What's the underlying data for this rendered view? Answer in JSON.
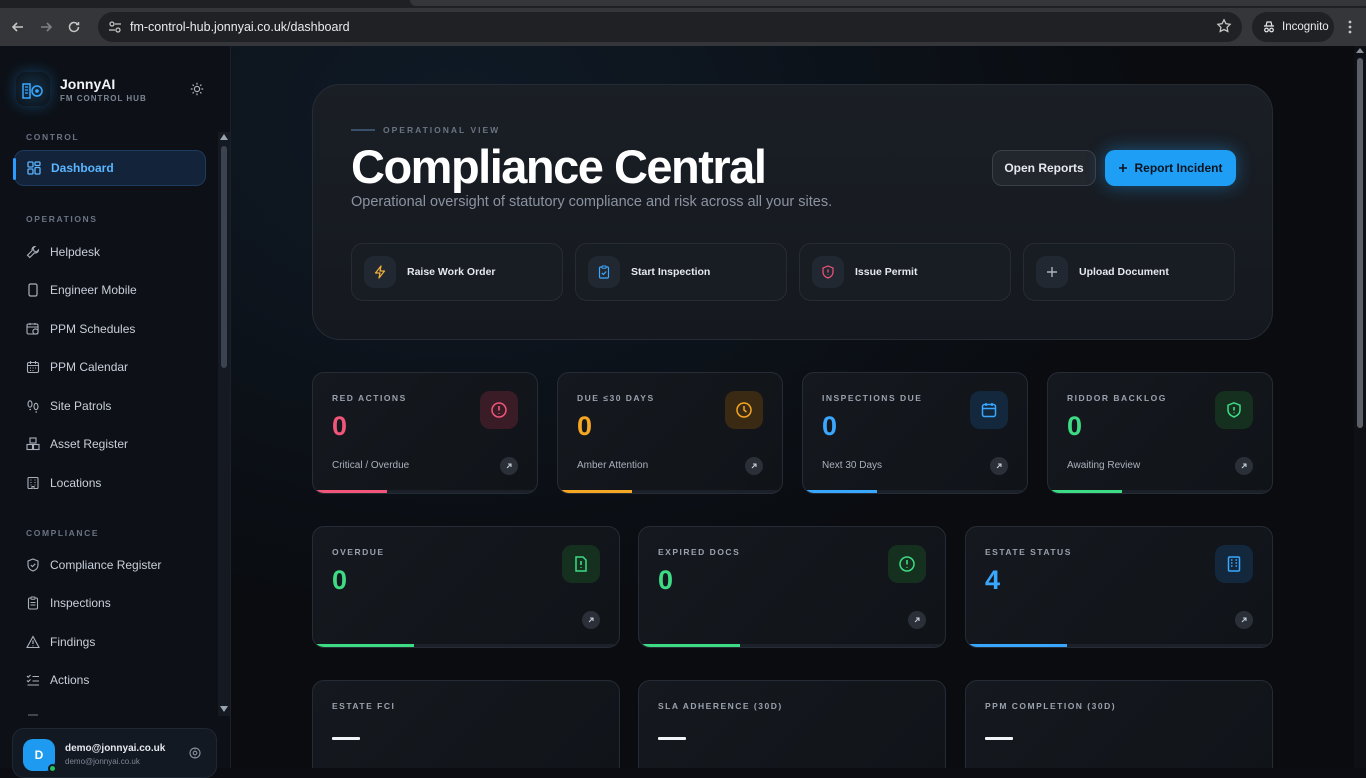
{
  "browser": {
    "url": "fm-control-hub.jonnyai.co.uk/dashboard",
    "profile_label": "Incognito"
  },
  "sidebar": {
    "brand_name": "JonnyAI",
    "brand_sub": "FM CONTROL HUB",
    "sections": [
      {
        "label": "CONTROL",
        "items": [
          {
            "label": "Dashboard",
            "icon": "grid-icon",
            "active": true
          }
        ]
      },
      {
        "label": "OPERATIONS",
        "items": [
          {
            "label": "Helpdesk",
            "icon": "wrench-icon"
          },
          {
            "label": "Engineer Mobile",
            "icon": "phone-icon"
          },
          {
            "label": "PPM Schedules",
            "icon": "calendar-clock-icon"
          },
          {
            "label": "PPM Calendar",
            "icon": "calendar-icon"
          },
          {
            "label": "Site Patrols",
            "icon": "footprints-icon"
          },
          {
            "label": "Asset Register",
            "icon": "boxes-icon"
          },
          {
            "label": "Locations",
            "icon": "building-icon"
          }
        ]
      },
      {
        "label": "COMPLIANCE",
        "items": [
          {
            "label": "Compliance Register",
            "icon": "shield-check-icon"
          },
          {
            "label": "Inspections",
            "icon": "clipboard-icon"
          },
          {
            "label": "Findings",
            "icon": "warning-triangle-icon"
          },
          {
            "label": "Actions",
            "icon": "list-check-icon"
          }
        ]
      }
    ],
    "user": {
      "initial": "D",
      "email": "demo@jonnyai.co.uk",
      "sub": "demo@jonnyai.co.uk"
    }
  },
  "hero": {
    "eyebrow": "OPERATIONAL VIEW",
    "title": "Compliance Central",
    "subtitle": "Operational oversight of statutory compliance and risk across all your sites.",
    "open_reports_label": "Open Reports",
    "report_incident_label": "Report Incident",
    "quick_actions": [
      {
        "label": "Raise Work Order",
        "icon": "lightning-icon",
        "color": "#f5b13d"
      },
      {
        "label": "Start Inspection",
        "icon": "clipboard-check-icon",
        "color": "#3aa7ff"
      },
      {
        "label": "Issue Permit",
        "icon": "shield-alert-icon",
        "color": "#f2557a"
      },
      {
        "label": "Upload Document",
        "icon": "plus-icon",
        "color": "#aab1bc"
      }
    ]
  },
  "kpis_row1": [
    {
      "label": "RED ACTIONS",
      "value": "0",
      "sub": "Critical / Overdue",
      "color": "#f2557a",
      "icon": "alert-circle-icon",
      "progress": 0.33
    },
    {
      "label": "DUE ≤30 DAYS",
      "value": "0",
      "sub": "Amber Attention",
      "color": "#f5a623",
      "icon": "clock-icon",
      "progress": 0.33
    },
    {
      "label": "INSPECTIONS DUE",
      "value": "0",
      "sub": "Next 30 Days",
      "color": "#3aa7ff",
      "icon": "calendar-icon",
      "progress": 0.33
    },
    {
      "label": "RIDDOR BACKLOG",
      "value": "0",
      "sub": "Awaiting Review",
      "color": "#3ddc84",
      "icon": "shield-alert-icon",
      "progress": 0.33
    }
  ],
  "kpis_row2": [
    {
      "label": "OVERDUE",
      "value": "0",
      "color": "#3ddc84",
      "icon": "file-alert-icon",
      "progress": 0.33
    },
    {
      "label": "EXPIRED DOCS",
      "value": "0",
      "color": "#3ddc84",
      "icon": "alert-circle-icon",
      "progress": 0.33
    },
    {
      "label": "ESTATE STATUS",
      "value": "4",
      "color": "#3aa7ff",
      "icon": "building-icon",
      "progress": 0.33
    }
  ],
  "kpis_row3": [
    {
      "label": "ESTATE FCI"
    },
    {
      "label": "SLA ADHERENCE (30D)"
    },
    {
      "label": "PPM COMPLETION (30D)"
    }
  ]
}
